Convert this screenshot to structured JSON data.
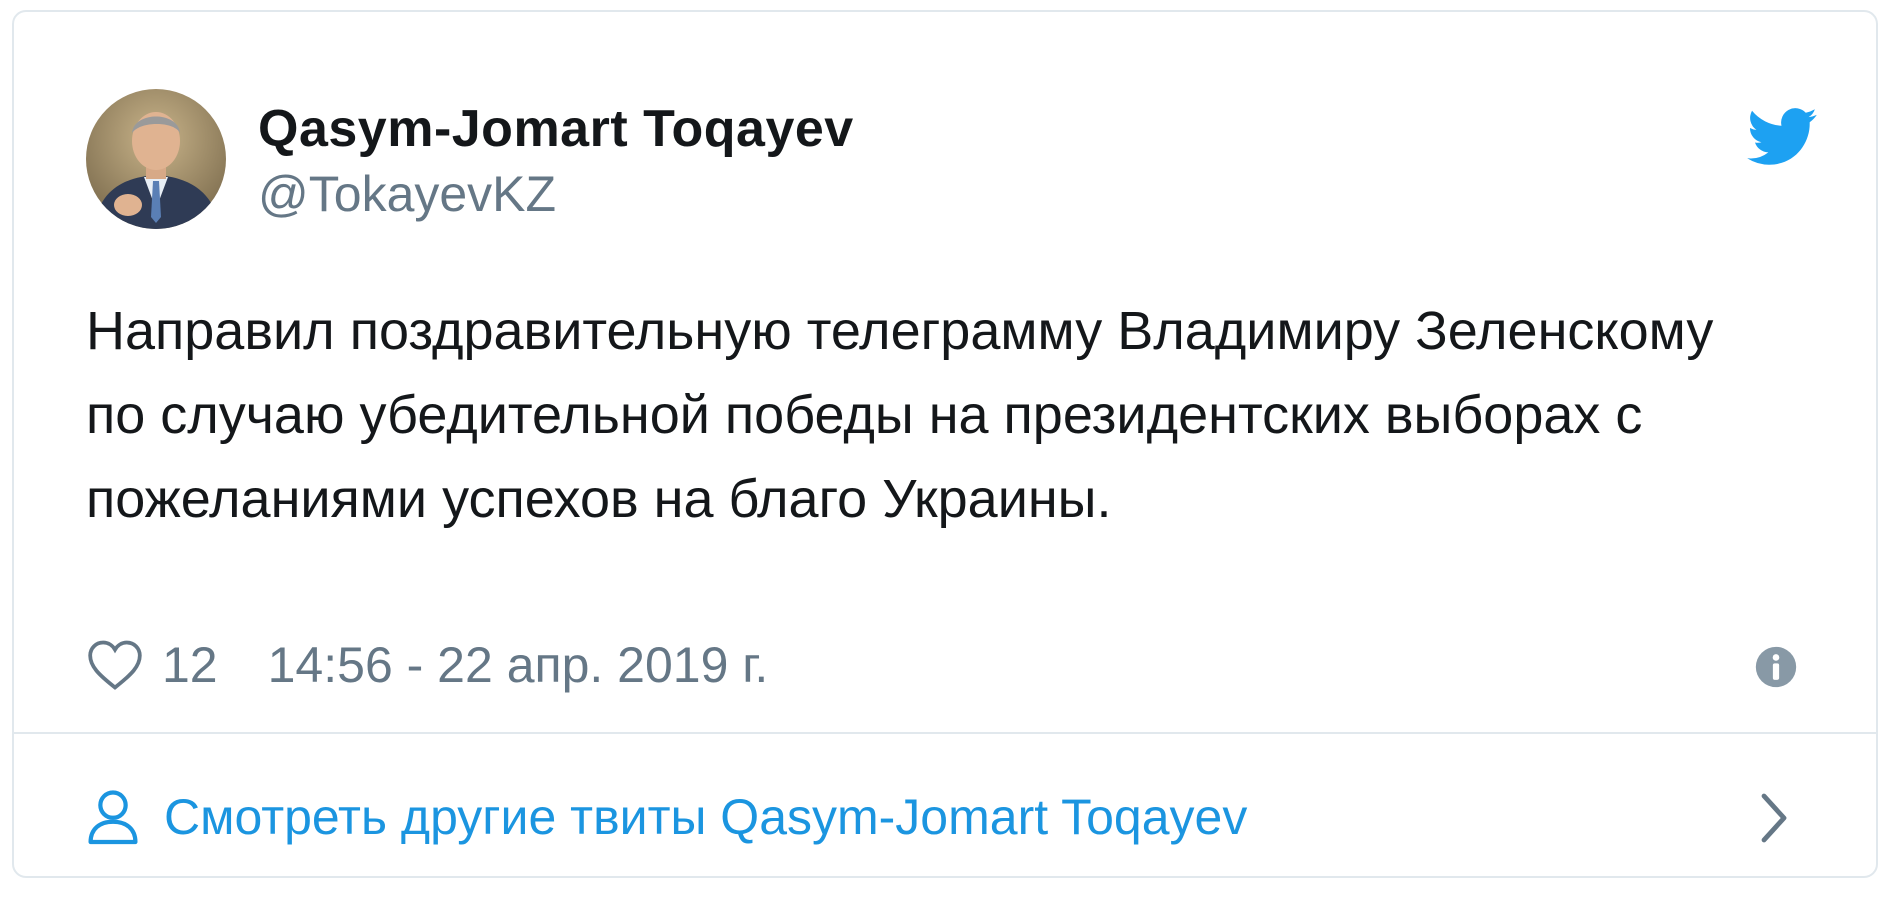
{
  "tweet": {
    "author_name": "Qasym-Jomart Toqayev",
    "author_handle": "@TokayevKZ",
    "text": "Направил поздравительную телеграмму Владимиру Зеленскому по случаю убедительной победы на президентских выборах с пожеланиями успехов на благо Украины.",
    "likes": "12",
    "timestamp": "14:56 - 22 апр. 2019 г."
  },
  "footer": {
    "more_tweets_label": "Смотреть другие твиты Qasym-Jomart Toqayev"
  },
  "icons": {
    "brand": "twitter-bird-icon",
    "like": "heart-icon",
    "info": "info-icon",
    "profile": "person-icon",
    "chevron": "chevron-right-icon"
  },
  "colors": {
    "brand_blue": "#1da1f2",
    "link_blue": "#1b95e0",
    "text_primary": "#14171a",
    "text_secondary": "#657786",
    "border": "#e1e8ed"
  }
}
